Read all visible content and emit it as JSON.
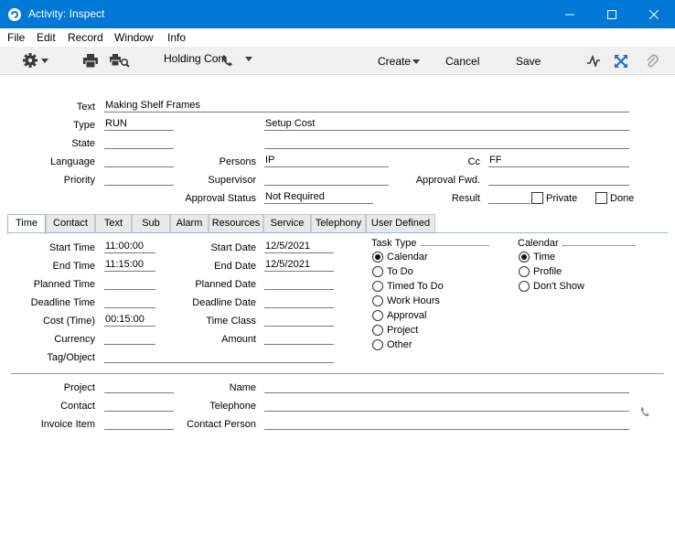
{
  "window": {
    "title": "Activity: Inspect"
  },
  "menu": [
    "File",
    "Edit",
    "Record",
    "Window",
    "Info"
  ],
  "toolbar": {
    "holding": "Holding Com",
    "create": "Create",
    "cancel": "Cancel",
    "save": "Save"
  },
  "header": {
    "text": {
      "label": "Text",
      "value": "Making Shelf Frames"
    },
    "type": {
      "label": "Type",
      "value": "RUN",
      "desc": "Setup Cost"
    },
    "state": {
      "label": "State",
      "value": ""
    },
    "language": {
      "label": "Language",
      "value": ""
    },
    "persons": {
      "label": "Persons",
      "value": "IP"
    },
    "cc": {
      "label": "Cc",
      "value": "FF"
    },
    "priority": {
      "label": "Priority",
      "value": ""
    },
    "supervisor": {
      "label": "Supervisor",
      "value": ""
    },
    "approval_fwd": {
      "label": "Approval Fwd.",
      "value": ""
    },
    "approval_status": {
      "label": "Approval Status",
      "value": "Not Required"
    },
    "result": {
      "label": "Result",
      "value": ""
    },
    "private": {
      "label": "Private",
      "checked": false
    },
    "done": {
      "label": "Done",
      "checked": false
    }
  },
  "tabs": [
    "Time",
    "Contact",
    "Text",
    "Sub",
    "Alarm",
    "Resources",
    "Service",
    "Telephony",
    "User Defined"
  ],
  "time_tab": {
    "start_time": {
      "label": "Start Time",
      "value": "11:00:00"
    },
    "end_time": {
      "label": "End Time",
      "value": "11:15:00"
    },
    "planned_time": {
      "label": "Planned Time",
      "value": ""
    },
    "deadline_time": {
      "label": "Deadline Time",
      "value": ""
    },
    "cost_time": {
      "label": "Cost (Time)",
      "value": "00:15:00"
    },
    "currency": {
      "label": "Currency",
      "value": ""
    },
    "tag_object": {
      "label": "Tag/Object",
      "value": ""
    },
    "start_date": {
      "label": "Start Date",
      "value": "12/5/2021"
    },
    "end_date": {
      "label": "End Date",
      "value": "12/5/2021"
    },
    "planned_date": {
      "label": "Planned Date",
      "value": ""
    },
    "deadline_date": {
      "label": "Deadline Date",
      "value": ""
    },
    "time_class": {
      "label": "Time Class",
      "value": ""
    },
    "amount": {
      "label": "Amount",
      "value": ""
    },
    "task_type": {
      "label": "Task Type",
      "options": [
        "Calendar",
        "To Do",
        "Timed To Do",
        "Work Hours",
        "Approval",
        "Project",
        "Other"
      ],
      "selected": "Calendar"
    },
    "calendar": {
      "label": "Calendar",
      "options": [
        "Time",
        "Profile",
        "Don't Show"
      ],
      "selected": "Time"
    }
  },
  "footer": {
    "project": {
      "label": "Project",
      "value": ""
    },
    "contact": {
      "label": "Contact",
      "value": ""
    },
    "invoice_item": {
      "label": "Invoice Item",
      "value": ""
    },
    "name": {
      "label": "Name",
      "value": ""
    },
    "telephone": {
      "label": "Telephone",
      "value": ""
    },
    "contact_person": {
      "label": "Contact Person",
      "value": ""
    }
  },
  "colors": {
    "titlebar": "#0078d7",
    "toolbar_bg": "#f0f0f0",
    "tab_accent": "#9ab9d6"
  }
}
